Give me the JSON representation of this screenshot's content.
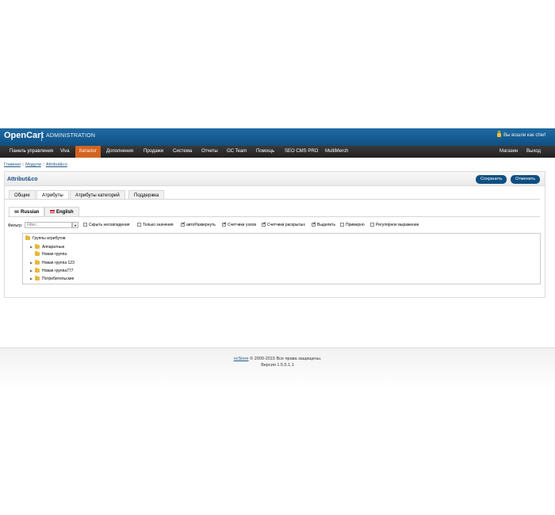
{
  "header": {
    "logo": "OpenCart",
    "subtitle": "ADMINISTRATION",
    "login_text": "Вы вошли как chief",
    "lock_icon": "lock-icon"
  },
  "menu": {
    "items": [
      {
        "label": "Панель управления"
      },
      {
        "label": "Viva"
      },
      {
        "label": "Каталог",
        "active": true
      },
      {
        "label": "Дополнения"
      },
      {
        "label": "Продажи"
      },
      {
        "label": "Система"
      },
      {
        "label": "Отчеты"
      },
      {
        "label": "OC Team"
      },
      {
        "label": "Помощь"
      },
      {
        "label": "SEO CMS PRO"
      },
      {
        "label": "MultiMerch"
      }
    ],
    "right": [
      {
        "label": "Магазин"
      },
      {
        "label": "Выход"
      }
    ],
    "active_color": "#d4631f"
  },
  "breadcrumb": {
    "items": [
      "Главная",
      "Модули",
      "Attribut&co"
    ],
    "separator": "::"
  },
  "box": {
    "title": "Attribut&co",
    "save_label": "Сохранить",
    "cancel_label": "Отменить"
  },
  "tabs": [
    "Общие",
    "Атрибуты",
    "Атрибуты категорий",
    "Поддержка"
  ],
  "languages": [
    "Russian",
    "English"
  ],
  "filter": {
    "label": "Фильтр:",
    "placeholder": "Filter...",
    "options": [
      {
        "label": "Скрыть несовпадения",
        "checked": false
      },
      {
        "label": "Только значения",
        "checked": false
      },
      {
        "label": "автоРазвернуть",
        "checked": true
      },
      {
        "label": "Счетчики узлов",
        "checked": true
      },
      {
        "label": "Счетчики раскрытых",
        "checked": true
      },
      {
        "label": "Выделить",
        "checked": true
      },
      {
        "label": "Примерно",
        "checked": false
      },
      {
        "label": "Регулярное выражение",
        "checked": false
      }
    ]
  },
  "tree": {
    "root": "Группы атрибутов",
    "items": [
      {
        "label": "Аппаратные",
        "expandable": true
      },
      {
        "label": "Новая группа",
        "expandable": false
      },
      {
        "label": "Новая группа 123",
        "expandable": true
      },
      {
        "label": "Новая группа777",
        "expandable": true
      },
      {
        "label": "Потребительские",
        "expandable": true
      }
    ]
  },
  "footer": {
    "brand": "ocStore",
    "copyright": "© 2009-2015 Все права защищены.",
    "version": "Версия 1.5.5.1.1"
  }
}
